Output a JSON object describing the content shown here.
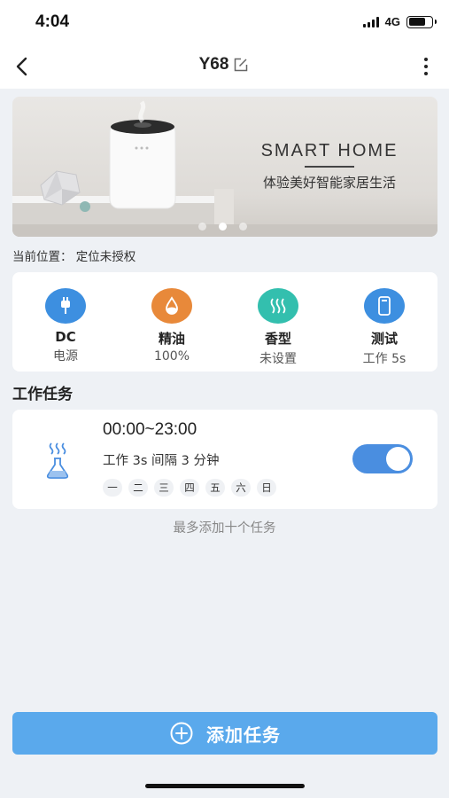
{
  "status_bar": {
    "time": "4:04",
    "network": "4G"
  },
  "nav": {
    "title": "Y68",
    "back_icon": "chevron-left-icon",
    "edit_icon": "edit-icon",
    "more_icon": "more-vertical-icon"
  },
  "banner": {
    "heading": "SMART HOME",
    "subtitle": "体验美好智能家居生活",
    "slide_count": 3,
    "active_slide": 2
  },
  "location": {
    "text": "当前位置：  定位未授权"
  },
  "info": [
    {
      "label": "DC",
      "value": "电源",
      "icon": "plug-icon",
      "color": "#3d8fe0"
    },
    {
      "label": "精油",
      "value": "100%",
      "icon": "oil-drop-icon",
      "color": "#e8893a"
    },
    {
      "label": "香型",
      "value": "未设置",
      "icon": "scent-waves-icon",
      "color": "#33bfae"
    },
    {
      "label": "测试",
      "value": "工作 5s",
      "icon": "device-icon",
      "color": "#3d8fe0"
    }
  ],
  "tasks_section": {
    "title": "工作任务"
  },
  "task": {
    "time_range": "00:00~23:00",
    "description": "工作 3s  间隔 3 分钟",
    "weekdays": [
      "一",
      "二",
      "三",
      "四",
      "五",
      "六",
      "日"
    ],
    "enabled": true,
    "icon": "diffuser-flask-icon"
  },
  "task_hint": "最多添加十个任务",
  "add_button": {
    "label": "添加任务",
    "icon": "plus-circle-icon"
  },
  "colors": {
    "accent": "#4a8ee0",
    "button": "#5aa9ec",
    "background": "#eef1f5"
  }
}
